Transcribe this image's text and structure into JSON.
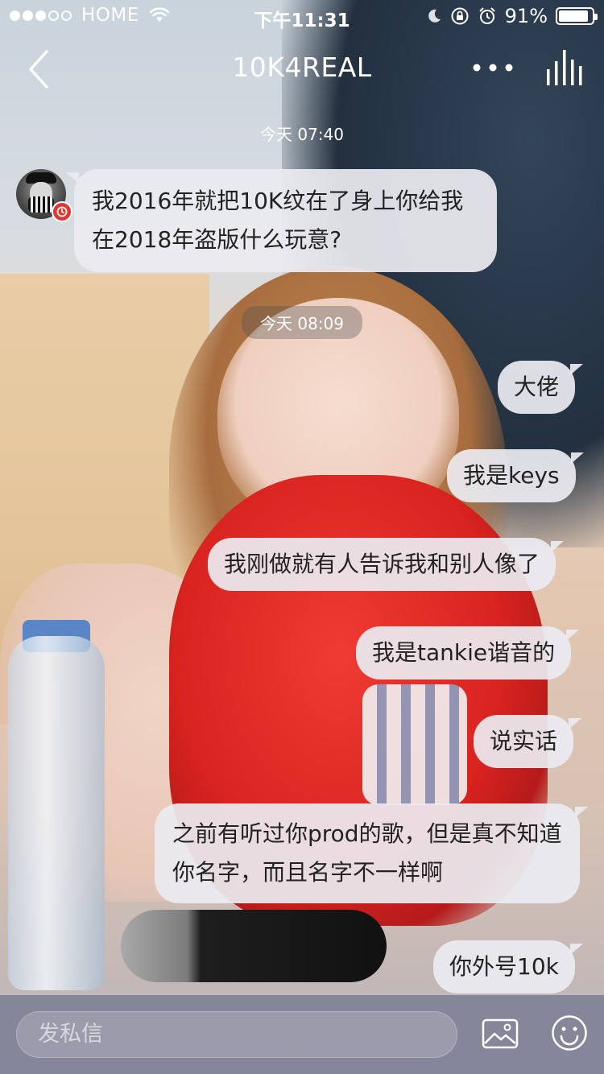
{
  "status_bar": {
    "signal_filled": 3,
    "signal_total": 5,
    "carrier": "HOME",
    "time": "下午11:31",
    "battery": "91%",
    "battery_level": 0.91,
    "icons": [
      "wifi-icon",
      "moon-icon",
      "rotation-lock-icon",
      "alarm-icon",
      "battery-icon"
    ]
  },
  "nav": {
    "title": "10K4REAL",
    "icons": [
      "back-icon",
      "more-icon",
      "equalizer-icon"
    ]
  },
  "chat": {
    "timestamps": [
      "今天 07:40",
      "今天 08:09"
    ],
    "incoming": [
      {
        "text": "我2016年就把10K纹在了身上你给我在2018年盗版什么玩意?"
      }
    ],
    "outgoing": [
      {
        "text": "大佬"
      },
      {
        "text": "我是keys"
      },
      {
        "text": "我刚做就有人告诉我和别人像了"
      },
      {
        "text": "我是tankie谐音的"
      },
      {
        "text": "说实话"
      },
      {
        "text": "之前有听过你prod的歌，但是真不知道你名字，而且名字不一样啊"
      },
      {
        "text": "你外号10k"
      }
    ]
  },
  "input_bar": {
    "placeholder": "发私信",
    "icons": [
      "image-icon",
      "emoji-icon"
    ]
  },
  "colors": {
    "bubble": "#EBEBF0",
    "input_bar": "#7D7F96",
    "badge": "#E2362F"
  }
}
